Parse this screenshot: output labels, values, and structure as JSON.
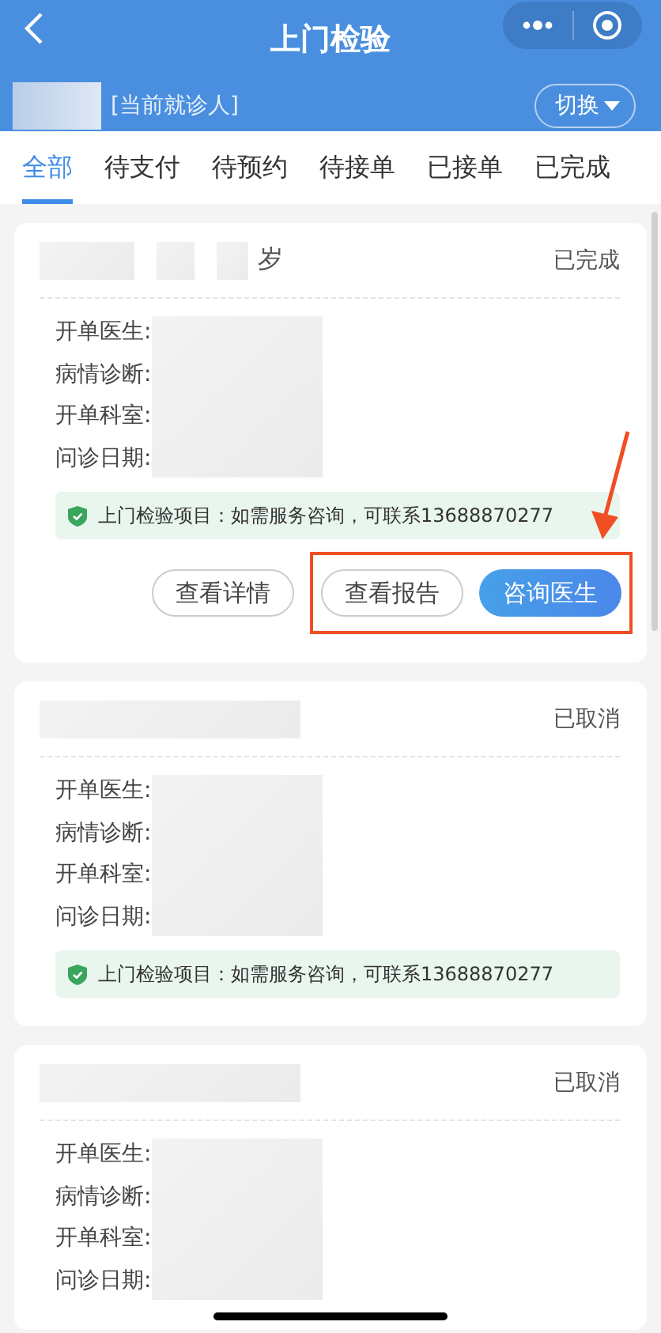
{
  "nav": {
    "title": "上门检验"
  },
  "patient": {
    "label": "[当前就诊人]",
    "switch": "切换"
  },
  "tabs": [
    {
      "label": "全部",
      "selected": true
    },
    {
      "label": "待支付",
      "selected": false
    },
    {
      "label": "待预约",
      "selected": false
    },
    {
      "label": "待接单",
      "selected": false
    },
    {
      "label": "已接单",
      "selected": false
    },
    {
      "label": "已完成",
      "selected": false
    }
  ],
  "orders": [
    {
      "age_unit": "岁",
      "status": "已完成",
      "fields": [
        "开单医生:",
        "病情诊断:",
        "开单科室:",
        "问诊日期:"
      ],
      "notice": "上门检验项目：如需服务咨询，可联系13688870277",
      "arrow": true,
      "buttons": [
        {
          "label": "查看详情",
          "kind": "outline",
          "highlighted": false
        },
        {
          "label": "查看报告",
          "kind": "outline",
          "highlighted": true
        },
        {
          "label": "咨询医生",
          "kind": "primary",
          "highlighted": true
        }
      ]
    },
    {
      "status": "已取消",
      "fields": [
        "开单医生:",
        "病情诊断:",
        "开单科室:",
        "问诊日期:"
      ],
      "notice": "上门检验项目：如需服务咨询，可联系13688870277",
      "arrow": false
    },
    {
      "status": "已取消",
      "fields": [
        "开单医生:",
        "病情诊断:",
        "开单科室:",
        "问诊日期:"
      ],
      "arrow": false
    }
  ]
}
